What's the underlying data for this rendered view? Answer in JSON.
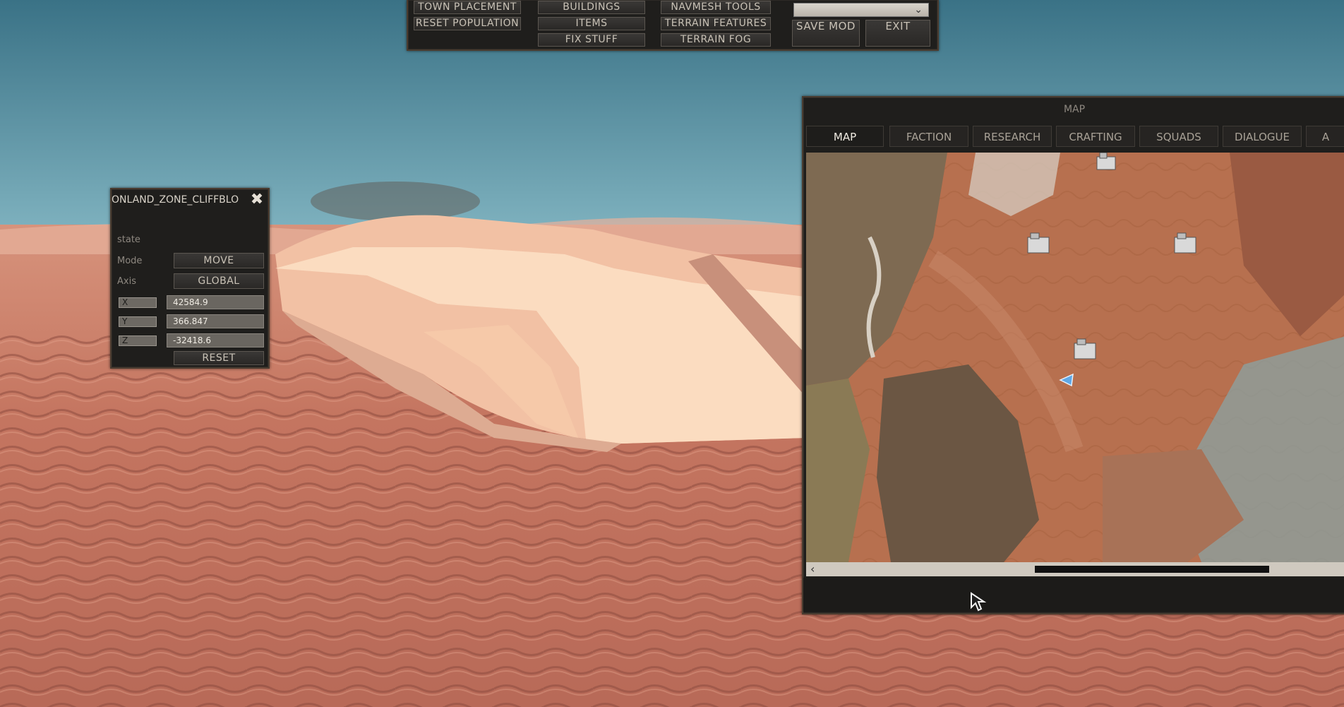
{
  "toolbar": {
    "col1": [
      "TOWN PLACEMENT",
      "RESET POPULATION"
    ],
    "col2": [
      "BUILDINGS",
      "ITEMS",
      "FIX STUFF"
    ],
    "col3": [
      "NAVMESH TOOLS",
      "TERRAIN FEATURES",
      "TERRAIN FOG"
    ],
    "dropdown_value": "",
    "save_label": "SAVE MOD",
    "exit_label": "EXIT"
  },
  "inspector": {
    "title": "ONLAND_ZONE_CLIFFBLO",
    "state_label": "state",
    "mode_label": "Mode",
    "mode_value": "MOVE",
    "axis_label": "Axis",
    "axis_value": "GLOBAL",
    "x_label": "X",
    "x_value": "42584.9",
    "y_label": "Y",
    "y_value": "366.847",
    "z_label": "Z",
    "z_value": "-32418.6",
    "reset_label": "RESET"
  },
  "map_window": {
    "title": "MAP",
    "tabs": [
      "MAP",
      "FACTION",
      "RESEARCH",
      "CRAFTING",
      "SQUADS",
      "DIALOGUE",
      "A"
    ],
    "active_tab": "MAP"
  },
  "colors": {
    "sky": "#3e7e92",
    "sand": "#c97d68",
    "panel": "#1f1e1c",
    "panel_border": "#4a3c30",
    "player_marker": "#5fa8e6"
  },
  "icons": [
    "close-icon",
    "chevron-down-icon",
    "town-icon",
    "player-arrow-icon",
    "cursor-arrow-icon",
    "chevron-left-icon"
  ]
}
